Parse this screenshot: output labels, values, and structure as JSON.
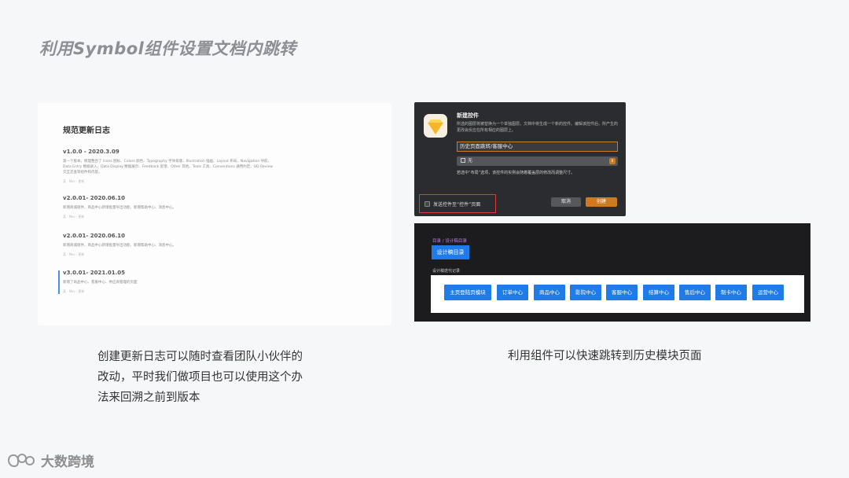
{
  "title": "利用Symbol组件设置文档内跳转",
  "changelog": {
    "heading": "规范更新日志",
    "entries": [
      {
        "version": "v1.0.0 - 2020.3.09",
        "desc": "第一个版本，梳理整合了 Icons 图标、Colors 颜色、Typography 字体排版、Illustration 插画、Layout 布局、Navigation 导航、Data Entry 数据录入、Data Display 数据展示、Feedback 反馈、Other 其他、Tools 工具、Conventions 通用约定、UD Review 交互走查等组件和内容。",
        "meta": "某 · Nov · 更新"
      },
      {
        "version": "v2.0.01- 2020.06.10",
        "desc": "新增商城组件、商品中心新增批量导出功能、新增帮助中心、消息中心。",
        "meta": "某 · Nov · 更新"
      },
      {
        "version": "v2.0.01- 2020.06.10",
        "desc": "新增商城组件、商品中心新增批量导出功能、新增帮助中心、消息中心。",
        "meta": "某 · Nov · 更新"
      },
      {
        "version": "v3.0.01- 2021.01.05",
        "desc": "新增了商品中心、客服中心、供应商管理的页面",
        "meta": "某 · Nov · 更新"
      }
    ],
    "caption": [
      "创建更新日志可以随时查看团队小伙伴的",
      "改动，平时我们做项目也可以使用这个办",
      "法来回溯之前到版本"
    ]
  },
  "dialog": {
    "heading": "新建控件",
    "description": "所选的图层将被替换为一个单独图层。文档中将生成一个新的控件。编辑该控件后，所产生的更改会反应在所有相应的图层上。",
    "name_value": "历史页面跳转/客服中心",
    "select_value": "无",
    "note": "若选中“布局”选项，该控件的实例会随着覆盖层的修改而调整尺寸。",
    "send_label": "发送控件至“控件”页面",
    "cancel_label": "取消",
    "create_label": "创建"
  },
  "directory": {
    "breadcrumb_link": "目录",
    "breadcrumb_sep": " / ",
    "breadcrumb_current": "设计稿目录",
    "button": "设计稿目录",
    "subtitle": "设计稿迭代记录",
    "modules": [
      "主页登陆页模块",
      "订单中心",
      "商品中心",
      "影院中心",
      "客服中心",
      "结算中心",
      "售后中心",
      "制卡中心",
      "运营中心"
    ],
    "caption": "利用组件可以快速跳转到历史模块页面"
  },
  "brand": "大数跨境",
  "colors": {
    "accent_blue": "#1e7be8",
    "accent_orange": "#d07a1e",
    "highlight_red": "#e03a3a"
  }
}
